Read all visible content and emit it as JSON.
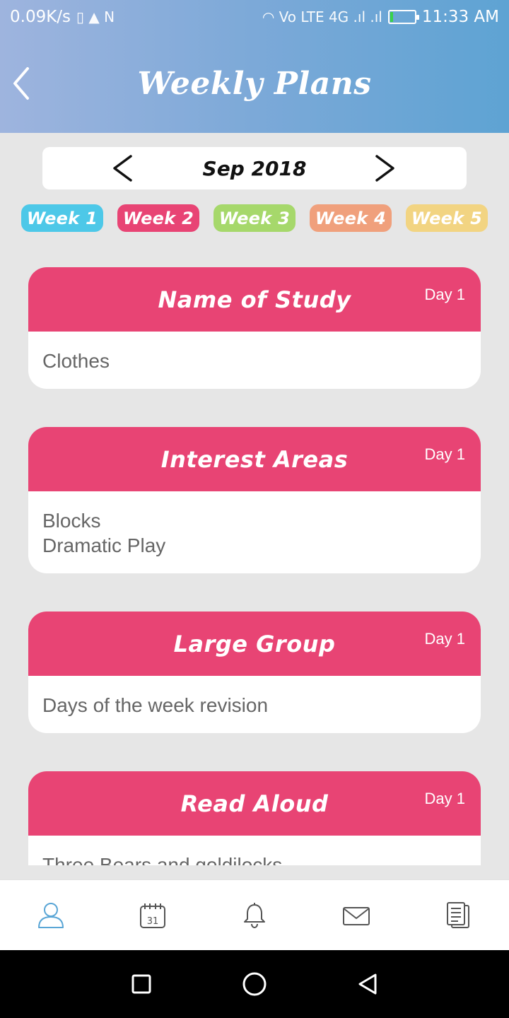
{
  "status_bar": {
    "net_speed": "0.09K/s",
    "left_glyphs": "▯ ▲ N",
    "right_glyphs": "◠ Vo LTE 4G .ıl .ıl",
    "time": "11:33 AM",
    "battery_level": 0.12,
    "battery_color": "#3ad24a"
  },
  "header": {
    "title": "Weekly Plans",
    "back_icon": "chevron-left-icon"
  },
  "month_selector": {
    "label": "Sep 2018",
    "prev_icon": "chevron-left-icon",
    "next_icon": "chevron-right-icon"
  },
  "weeks": [
    {
      "label": "Week 1",
      "color": "#4dc8e8"
    },
    {
      "label": "Week 2",
      "color": "#e84474"
    },
    {
      "label": "Week 3",
      "color": "#a6d86b"
    },
    {
      "label": "Week 4",
      "color": "#f0a07c"
    },
    {
      "label": "Week 5",
      "color": "#f2d482"
    }
  ],
  "cards": [
    {
      "title": "Name of Study",
      "day": "Day 1",
      "lines": [
        "Clothes"
      ]
    },
    {
      "title": "Interest Areas",
      "day": "Day 1",
      "lines": [
        "Blocks",
        "Dramatic Play"
      ]
    },
    {
      "title": "Large Group",
      "day": "Day 1",
      "lines": [
        "Days of the week revision"
      ]
    },
    {
      "title": "Read Aloud",
      "day": "Day 1",
      "lines": [
        "Three Bears and goldilocks"
      ]
    }
  ],
  "colors": {
    "accent": "#e84474",
    "header_gradient_start": "#9eb4de",
    "header_gradient_end": "#5ea3d3",
    "nav_active": "#5aa6d6",
    "nav_inactive": "#555555"
  },
  "bottom_nav": [
    {
      "icon": "profile-icon",
      "active": true
    },
    {
      "icon": "calendar-icon",
      "active": false,
      "label": "31"
    },
    {
      "icon": "bell-icon",
      "active": false
    },
    {
      "icon": "mail-icon",
      "active": false
    },
    {
      "icon": "documents-icon",
      "active": false
    }
  ],
  "system_nav": [
    "recents-square-icon",
    "home-circle-icon",
    "back-triangle-icon"
  ]
}
